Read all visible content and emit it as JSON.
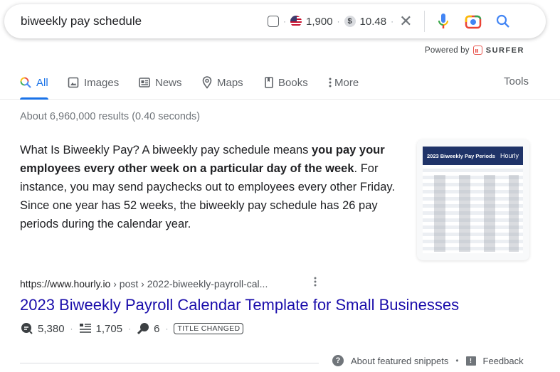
{
  "search": {
    "query": "biweekly pay schedule",
    "volume": "1,900",
    "cpc": "10.48",
    "icons": [
      "checkbox-icon",
      "us-flag-icon",
      "dollar-icon",
      "clear-icon",
      "microphone-icon",
      "camera-lens-icon",
      "search-icon"
    ]
  },
  "powered_by": {
    "label": "Powered by",
    "brand": "SURFER"
  },
  "tabs": [
    {
      "label": "All",
      "icon": "search-icon",
      "active": true
    },
    {
      "label": "Images",
      "icon": "image-icon"
    },
    {
      "label": "News",
      "icon": "news-icon"
    },
    {
      "label": "Maps",
      "icon": "map-pin-icon"
    },
    {
      "label": "Books",
      "icon": "book-icon"
    },
    {
      "label": "More",
      "icon": "kebab-icon"
    }
  ],
  "tools_label": "Tools",
  "result_stats": "About 6,960,000 results (0.40 seconds)",
  "snippet": {
    "text_before": "What Is Biweekly Pay? A biweekly pay schedule means ",
    "bold": "you pay your employees every other week on a particular day of the week",
    "text_after": ". For instance, you may send paychecks out to employees every other Friday. Since one year has 52 weeks, the biweekly pay schedule has 26 pay periods during the calendar year.",
    "thumbnail": {
      "title": "2023 Biweekly Pay Periods",
      "brand": "Hourly"
    }
  },
  "result": {
    "url_domain": "https://www.hourly.io",
    "url_path": " › post › 2022-biweekly-payroll-cal...",
    "title": "2023 Biweekly Payroll Calendar Template for Small Businesses",
    "metrics": {
      "traffic": "5,380",
      "words": "1,705",
      "keywords": "6",
      "badge": "TITLE CHANGED"
    }
  },
  "footer": {
    "about": "About featured snippets",
    "feedback": "Feedback"
  }
}
